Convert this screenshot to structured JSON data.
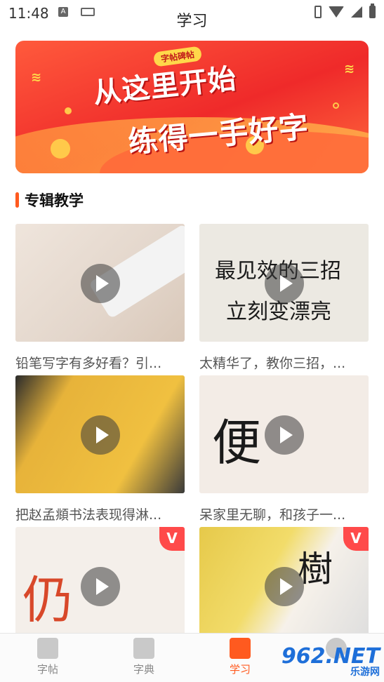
{
  "status_bar": {
    "time": "11:48",
    "indicator_a": "A"
  },
  "header": {
    "title": "学习"
  },
  "banner": {
    "tag": "字帖碑帖",
    "line1": "从这里开始",
    "line2": "练得一手好字"
  },
  "section": {
    "title": "专辑教学"
  },
  "cards": [
    {
      "caption": "铅笔写字有多好看？引...",
      "overlay": ""
    },
    {
      "caption": "太精华了，教你三招，...",
      "overlay": "最见效的三招",
      "overlay2": "立刻变漂亮"
    },
    {
      "caption": "把赵孟頫书法表现得淋...",
      "overlay": ""
    },
    {
      "caption": "呆家里无聊，和孩子一...",
      "overlay": "便"
    },
    {
      "caption": "",
      "overlay": "仍"
    },
    {
      "caption": "",
      "overlay": "樹"
    }
  ],
  "badge_glyph": "V",
  "nav": [
    {
      "label": "字帖",
      "icon": "pen-icon",
      "active": false
    },
    {
      "label": "字典",
      "icon": "book-icon",
      "active": false
    },
    {
      "label": "学习",
      "icon": "graduation-cap-icon",
      "active": true
    },
    {
      "label": "",
      "icon": "user-icon",
      "active": false
    }
  ],
  "watermark": {
    "brand": "962.NET",
    "sub": "乐游网"
  },
  "colors": {
    "accent": "#ff5a1f",
    "banner_red": "#ef2a2a"
  }
}
